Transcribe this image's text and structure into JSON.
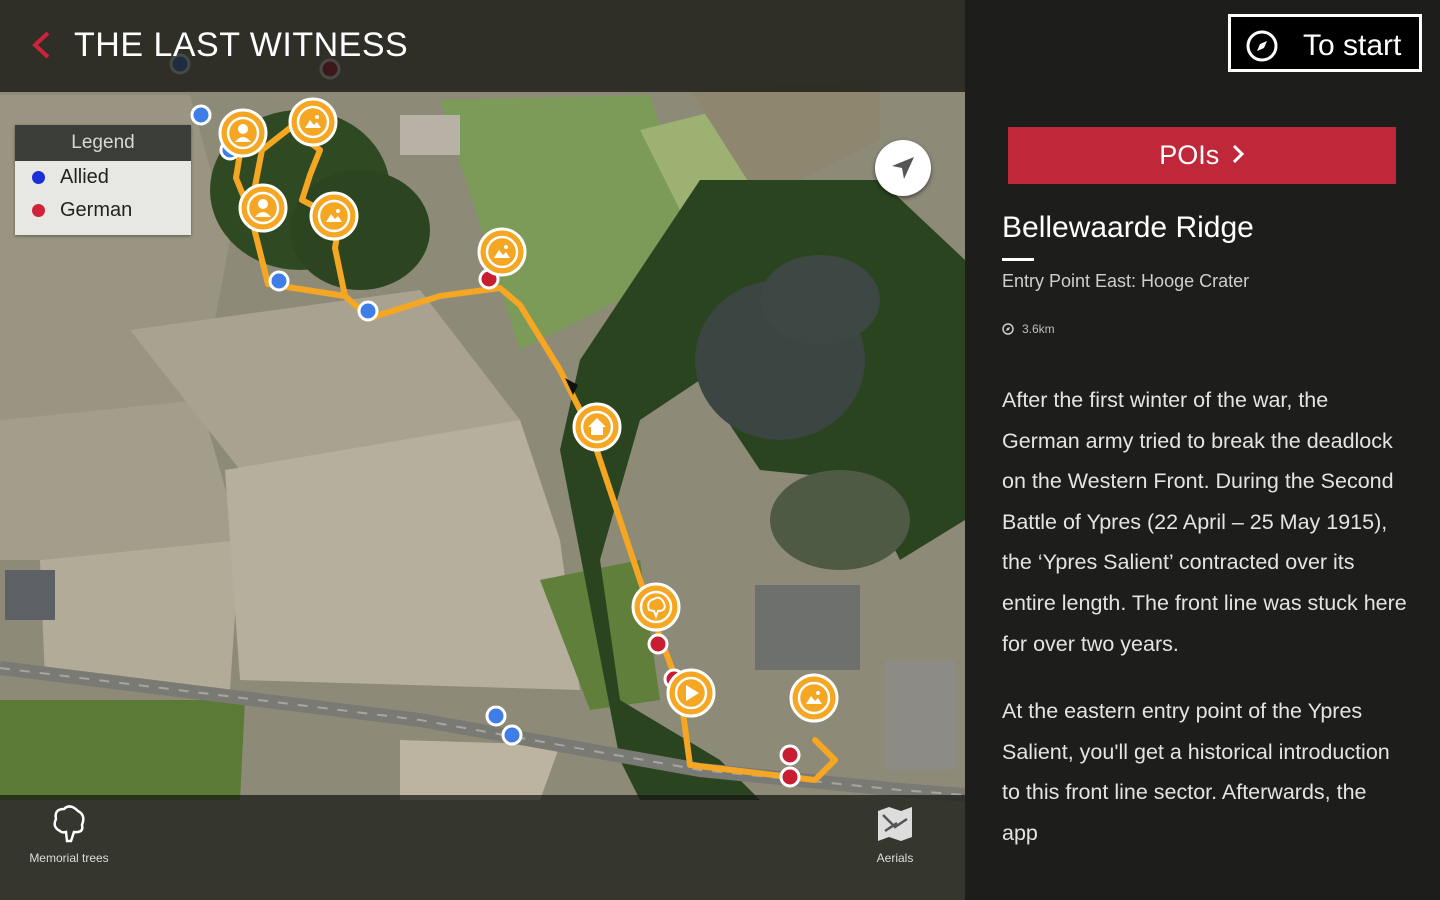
{
  "header": {
    "title": "THE LAST WITNESS"
  },
  "legend": {
    "header": "Legend",
    "items": [
      {
        "label": "Allied",
        "color": "#1c2fd6"
      },
      {
        "label": "German",
        "color": "#d0233a"
      }
    ]
  },
  "bottom_bar": {
    "memorial_trees_label": "Memorial trees",
    "aerials_label": "Aerials"
  },
  "map": {
    "route_color": "#f5a623",
    "markers": {
      "allied_color": "#3f7ee6",
      "german_color": "#c81e32",
      "poi_icons": [
        "person-icon",
        "image-icon",
        "person-icon",
        "image-icon",
        "image-icon",
        "home-icon",
        "tree-icon",
        "play-icon",
        "image-icon"
      ]
    }
  },
  "panel": {
    "start_button_label": "To start",
    "pois_button_label": "POIs",
    "poi_title": "Bellewaarde Ridge",
    "poi_subtitle": "Entry Point East: Hooge Crater",
    "poi_distance": "3.6km",
    "body_paragraphs": [
      "After the first winter of the war, the German army tried to break the deadlock on the Western Front. During the Second Battle of Ypres (22 April – 25 May 1915), the ‘Ypres Salient’ contracted over its entire length. The front line was stuck here for over two years.",
      "At the eastern entry point of the Ypres Salient, you'll get a historical introduction to this front line sector. Afterwards, the app"
    ]
  },
  "colors": {
    "accent_red": "#c0283a",
    "panel_bg": "#1d1d1b"
  }
}
